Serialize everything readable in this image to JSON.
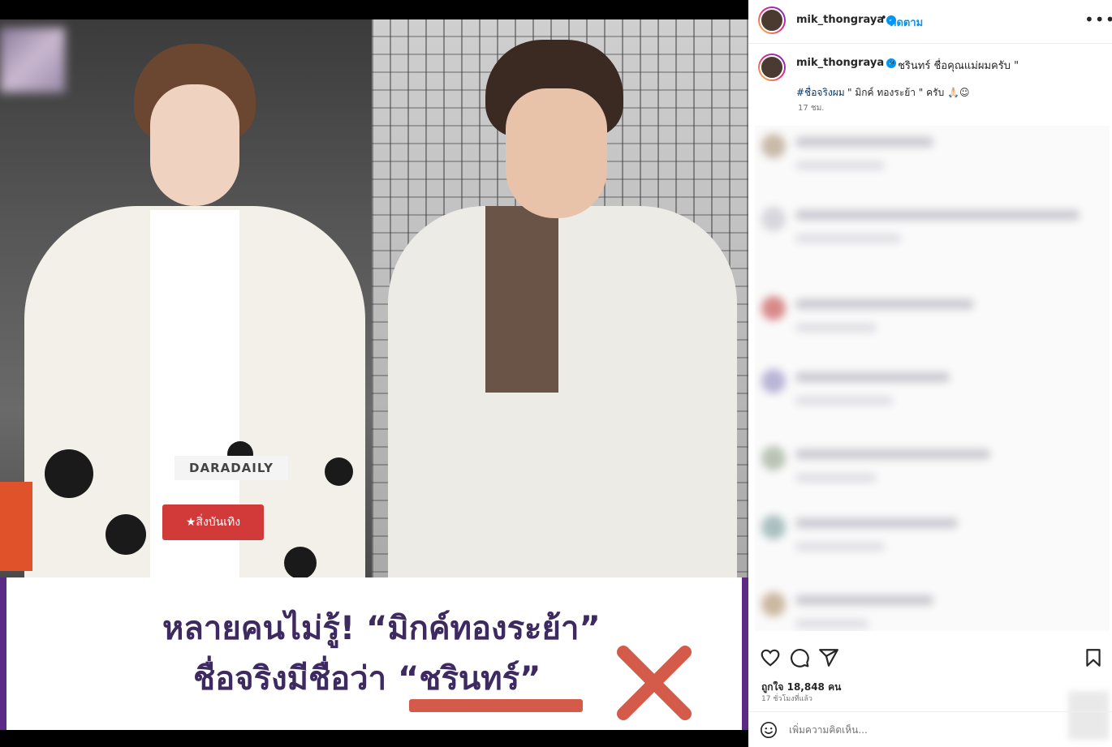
{
  "media": {
    "left_logo_text": "DARADAILY",
    "left_logo_red": "★สิ่งบันเทิง",
    "caption_line1": "หลายคนไม่รู้! “มิกค์ทองระย้า”",
    "caption_line2": "ชื่อจริงมีชื่อว่า “ชรินทร์”",
    "accent_color": "#5b2a86",
    "mark_color": "#d45a4a"
  },
  "post_header": {
    "username": "mik_thongraya",
    "separator": "•",
    "follow_label": "ติดตาม",
    "more_icon": "more-horizontal-icon"
  },
  "caption": {
    "username": "mik_thongraya",
    "text": "\" ชรินทร์ ชื่อคุณแม่ผมครับ \"",
    "hashtag": "#ชื่อจริงผม",
    "rest": "\" มิกค์ ทองระย้า \" ครับ 🙏🏻☺",
    "time": "17 ชม."
  },
  "comments": {
    "count_visible": 8
  },
  "footer": {
    "likes": "ถูกใจ 18,848 คน",
    "posted_ago": "17 ชั่วโมงที่แล้ว",
    "comment_placeholder": "เพิ่มความคิดเห็น..."
  }
}
